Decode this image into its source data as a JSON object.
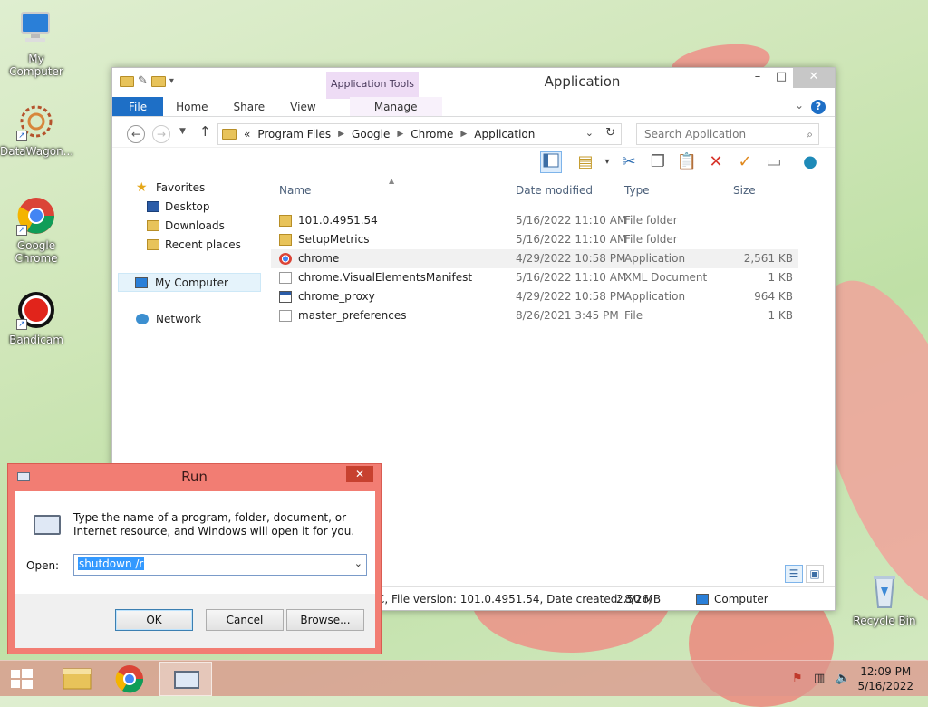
{
  "desktop": {
    "icons": [
      {
        "label": "My Computer"
      },
      {
        "label": "DataWagon..."
      },
      {
        "label": "Google Chrome"
      },
      {
        "label": "Bandicam"
      },
      {
        "label": "Recycle Bin"
      }
    ]
  },
  "explorer": {
    "title": "Application",
    "contextual_tab_group": "Application Tools",
    "tabs": [
      "File",
      "Home",
      "Share",
      "View",
      "Manage"
    ],
    "address": {
      "overflow": "«",
      "crumbs": [
        "Program Files",
        "Google",
        "Chrome",
        "Application"
      ]
    },
    "search_placeholder": "Search Application",
    "nav_pane": {
      "favorites": "Favorites",
      "favorites_items": [
        "Desktop",
        "Downloads",
        "Recent places"
      ],
      "computer": "My Computer",
      "network": "Network"
    },
    "columns": [
      "Name",
      "Date modified",
      "Type",
      "Size"
    ],
    "files": [
      {
        "name": "101.0.4951.54",
        "date": "5/16/2022 11:10 AM",
        "type": "File folder",
        "size": "",
        "icon": "folder-icon"
      },
      {
        "name": "SetupMetrics",
        "date": "5/16/2022 11:10 AM",
        "type": "File folder",
        "size": "",
        "icon": "folder-icon"
      },
      {
        "name": "chrome",
        "date": "4/29/2022 10:58 PM",
        "type": "Application",
        "size": "2,561 KB",
        "icon": "chrome-icon"
      },
      {
        "name": "chrome.VisualElementsManifest",
        "date": "5/16/2022 11:10 AM",
        "type": "XML Document",
        "size": "1 KB",
        "icon": "xml-file-icon"
      },
      {
        "name": "chrome_proxy",
        "date": "4/29/2022 10:58 PM",
        "type": "Application",
        "size": "964 KB",
        "icon": "application-icon"
      },
      {
        "name": "master_preferences",
        "date": "8/26/2021 3:45 PM",
        "type": "File",
        "size": "1 KB",
        "icon": "file-icon"
      }
    ],
    "status": {
      "details": "C, File version: 101.0.4951.54, Date created: 8/26/",
      "size": "2.50 MB",
      "location": "Computer"
    }
  },
  "run_dialog": {
    "title": "Run",
    "description": "Type the name of a program, folder, document, or Internet resource, and Windows will open it for you.",
    "open_label": "Open:",
    "input_value": "shutdown /r",
    "buttons": {
      "ok": "OK",
      "cancel": "Cancel",
      "browse": "Browse..."
    }
  },
  "taskbar": {
    "time": "12:09 PM",
    "date": "5/16/2022"
  },
  "colors": {
    "accent": "#1e6fc6",
    "run_frame": "#f27d73",
    "selection": "#3399ff"
  }
}
